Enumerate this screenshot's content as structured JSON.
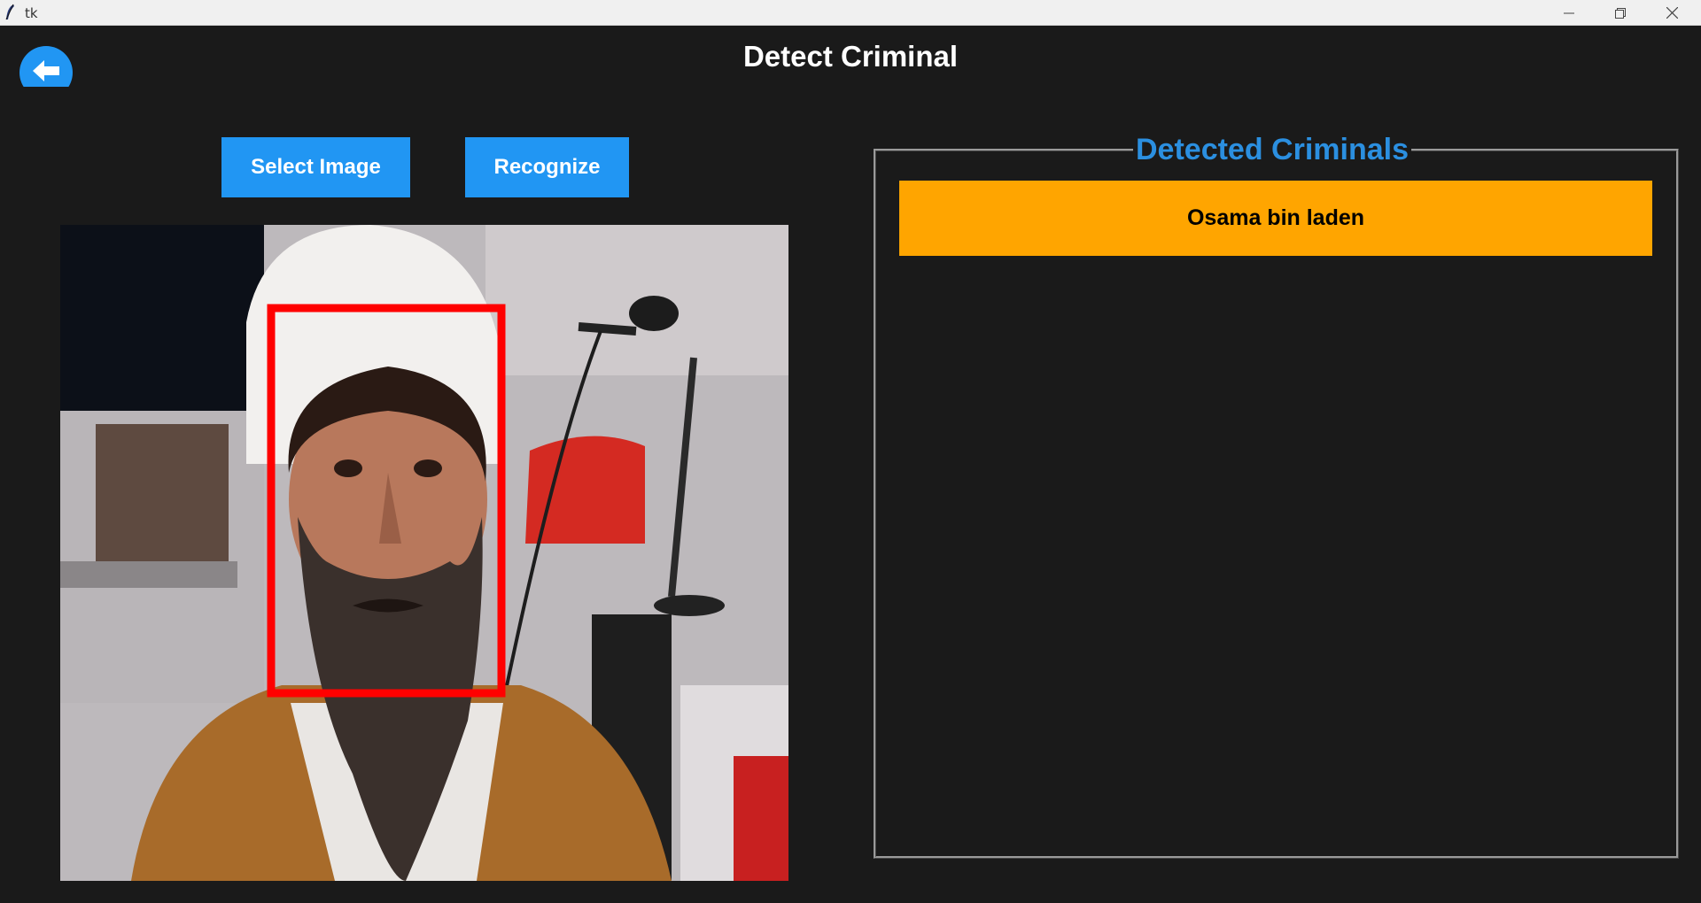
{
  "window": {
    "title": "tk",
    "controls": [
      "minimize",
      "restore",
      "close"
    ]
  },
  "header": {
    "title": "Detect Criminal",
    "back_icon": "arrow-left-icon"
  },
  "toolbar": {
    "select_label": "Select Image",
    "recognize_label": "Recognize"
  },
  "image_panel": {
    "detection_box_color": "#ff0000"
  },
  "results": {
    "group_title": "Detected Criminals",
    "items": [
      {
        "name": "Osama bin laden"
      }
    ]
  },
  "colors": {
    "background": "#1a1a1a",
    "accent": "#2196f3",
    "result_highlight": "#ffa500"
  }
}
